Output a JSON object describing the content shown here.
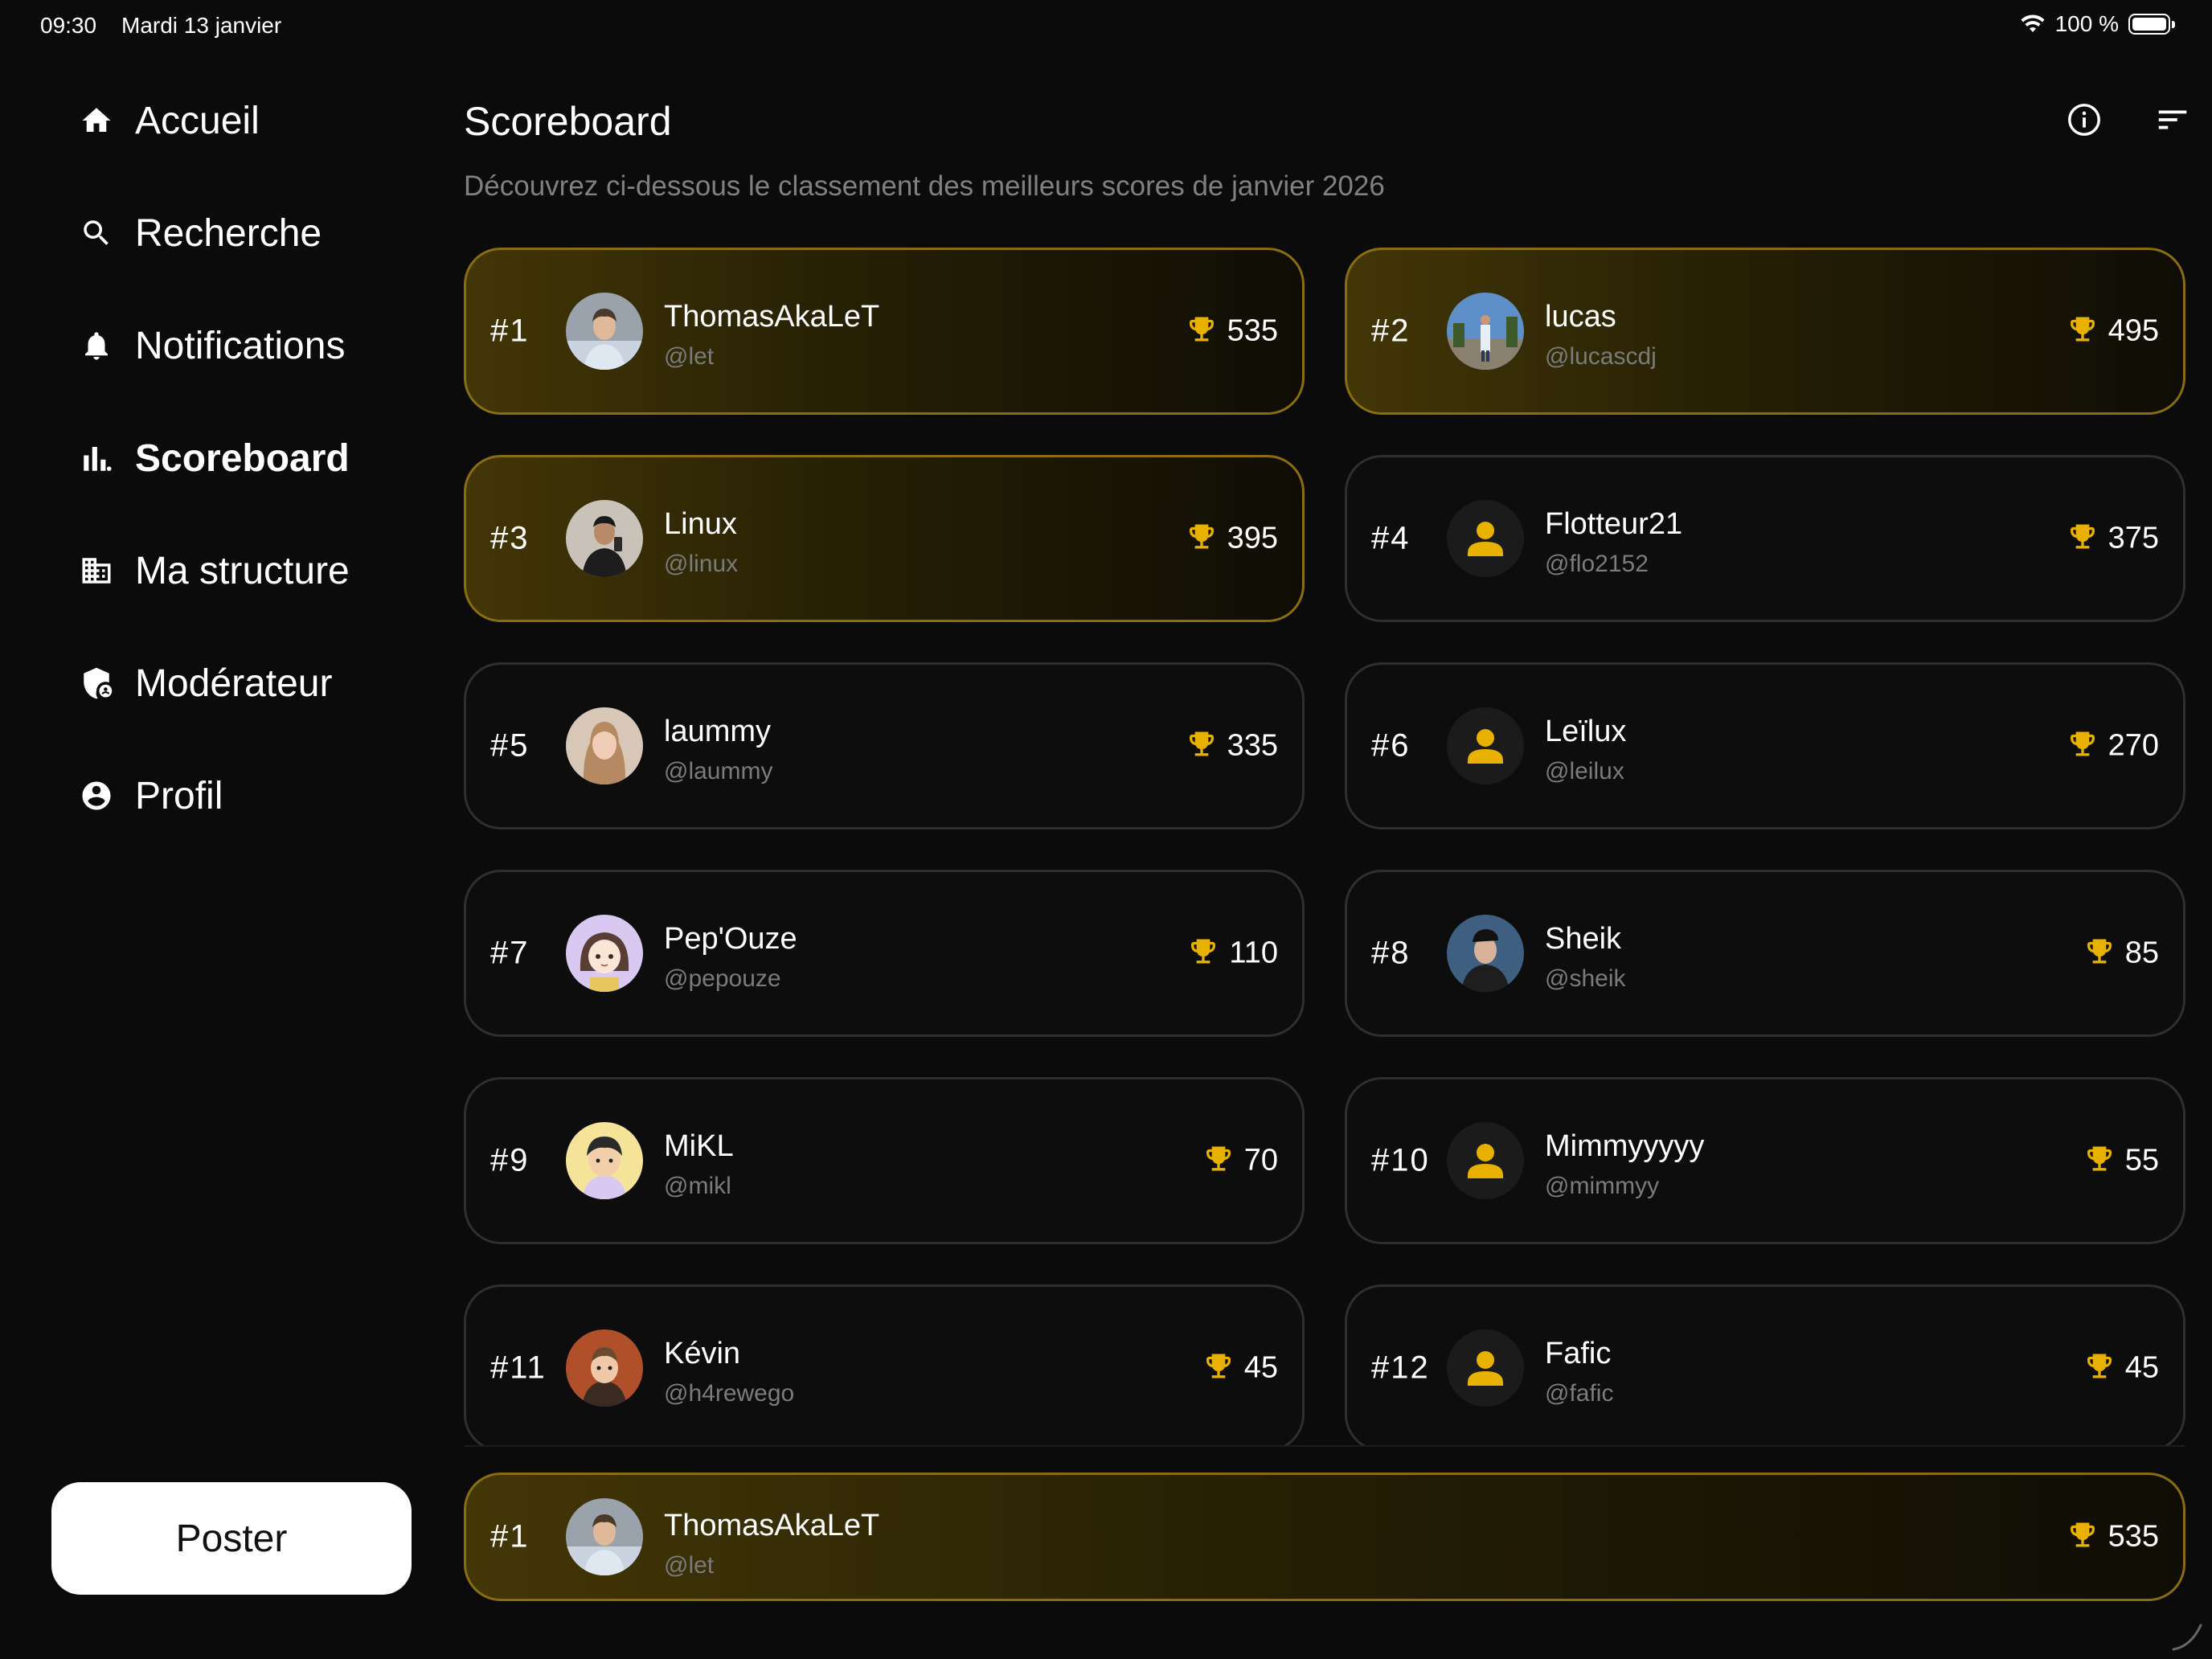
{
  "status_bar": {
    "time": "09:30",
    "date": "Mardi 13 janvier",
    "battery": "100 %"
  },
  "sidebar": {
    "items": [
      {
        "label": "Accueil",
        "icon": "home-icon"
      },
      {
        "label": "Recherche",
        "icon": "search-icon"
      },
      {
        "label": "Notifications",
        "icon": "bell-icon"
      },
      {
        "label": "Scoreboard",
        "icon": "bar-chart-icon",
        "active": true
      },
      {
        "label": "Ma structure",
        "icon": "building-icon"
      },
      {
        "label": "Modérateur",
        "icon": "shield-user-icon"
      },
      {
        "label": "Profil",
        "icon": "account-circle-icon"
      }
    ],
    "poster_label": "Poster"
  },
  "header": {
    "title": "Scoreboard",
    "subtitle": "Découvrez ci-dessous le classement des meilleurs scores de janvier 2026",
    "info_icon": "info-icon",
    "sort_icon": "sort-icon"
  },
  "ranking": [
    {
      "rank": "#1",
      "name": "ThomasAkaLeT",
      "handle": "@let",
      "score": "535",
      "highlight": true
    },
    {
      "rank": "#2",
      "name": "lucas",
      "handle": "@lucascdj",
      "score": "495",
      "highlight": true
    },
    {
      "rank": "#3",
      "name": "Linux",
      "handle": "@linux",
      "score": "395",
      "highlight": true
    },
    {
      "rank": "#4",
      "name": "Flotteur21",
      "handle": "@flo2152",
      "score": "375",
      "highlight": false
    },
    {
      "rank": "#5",
      "name": "laummy",
      "handle": "@laummy",
      "score": "335",
      "highlight": false
    },
    {
      "rank": "#6",
      "name": "Leïlux",
      "handle": "@leilux",
      "score": "270",
      "highlight": false
    },
    {
      "rank": "#7",
      "name": "Pep'Ouze",
      "handle": "@pepouze",
      "score": "110",
      "highlight": false
    },
    {
      "rank": "#8",
      "name": "Sheik",
      "handle": "@sheik",
      "score": "85",
      "highlight": false
    },
    {
      "rank": "#9",
      "name": "MiKL",
      "handle": "@mikl",
      "score": "70",
      "highlight": false
    },
    {
      "rank": "#10",
      "name": "Mimmyyyyy",
      "handle": "@mimmyy",
      "score": "55",
      "highlight": false
    },
    {
      "rank": "#11",
      "name": "Kévin",
      "handle": "@h4rewego",
      "score": "45",
      "highlight": false
    },
    {
      "rank": "#12",
      "name": "Fafic",
      "handle": "@fafic",
      "score": "45",
      "highlight": false
    }
  ],
  "current_user": {
    "rank": "#1",
    "name": "ThomasAkaLeT",
    "handle": "@let",
    "score": "535"
  },
  "colors": {
    "accent": "#e8b100",
    "card_border": "#2f2f2f",
    "top_border": "#8a6d10",
    "background": "#0b0b0b"
  }
}
